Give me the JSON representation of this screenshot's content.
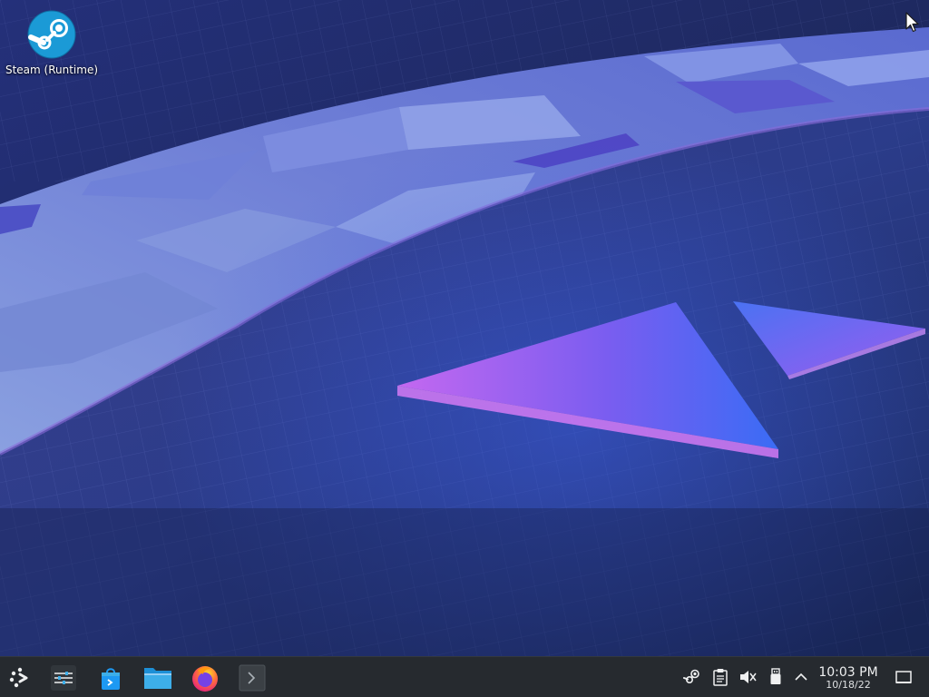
{
  "desktop": {
    "icons": [
      {
        "label": "Steam (Runtime)",
        "icon": "steam-icon"
      }
    ]
  },
  "taskbar": {
    "launchers": [
      {
        "name": "application-launcher",
        "icon": "steamdeck-logo-icon"
      },
      {
        "name": "system-settings",
        "icon": "sliders-icon"
      },
      {
        "name": "discover",
        "icon": "discover-shopping-bag-icon"
      },
      {
        "name": "dolphin-file-manager",
        "icon": "folder-icon"
      },
      {
        "name": "firefox",
        "icon": "firefox-icon"
      },
      {
        "name": "konsole",
        "icon": "terminal-icon"
      }
    ],
    "tray": [
      {
        "name": "steam-tray",
        "icon": "steam-small-icon"
      },
      {
        "name": "clipboard",
        "icon": "clipboard-icon"
      },
      {
        "name": "volume",
        "icon": "speaker-muted-icon"
      },
      {
        "name": "device-notifier",
        "icon": "usb-drive-icon"
      },
      {
        "name": "show-hidden-icons",
        "icon": "chevron-up-icon"
      }
    ],
    "clock": {
      "time": "10:03 PM",
      "date": "10/18/22"
    },
    "show_desktop": {
      "icon": "show-desktop-icon"
    }
  },
  "colors": {
    "taskbar_bg": "#262a2f",
    "wallpaper_base": "#1d2754",
    "accent_purple": "#b65cf0",
    "accent_blue": "#3b6ff5"
  }
}
